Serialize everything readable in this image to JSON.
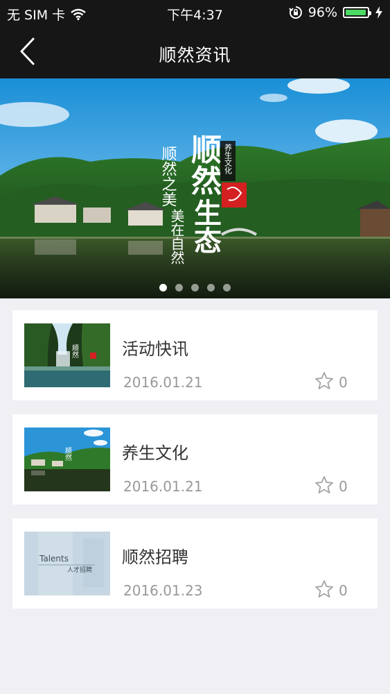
{
  "status": {
    "carrier": "无 SIM 卡",
    "time": "下午4:37",
    "battery": "96%",
    "battery_level": 0.96,
    "colors": {
      "battery_fill": "#4cd964"
    }
  },
  "nav": {
    "title": "顺然资讯",
    "back_icon": "chevron-left-icon"
  },
  "banner": {
    "calligraphy": {
      "main_1": "顺",
      "main_2": "然",
      "main_3": "生",
      "main_4": "态",
      "small": "养生文化",
      "sub_1": "顺然之美",
      "sub_2": "美在自然"
    },
    "page_count": 5,
    "active_index": 0
  },
  "news": [
    {
      "title": "活动快讯",
      "date": "2016.01.21",
      "favorites": "0"
    },
    {
      "title": "养生文化",
      "date": "2016.01.21",
      "favorites": "0"
    },
    {
      "title": "顺然招聘",
      "date": "2016.01.23",
      "favorites": "0",
      "thumb_text": "Talents",
      "thumb_subtext": "人才招聘"
    }
  ]
}
